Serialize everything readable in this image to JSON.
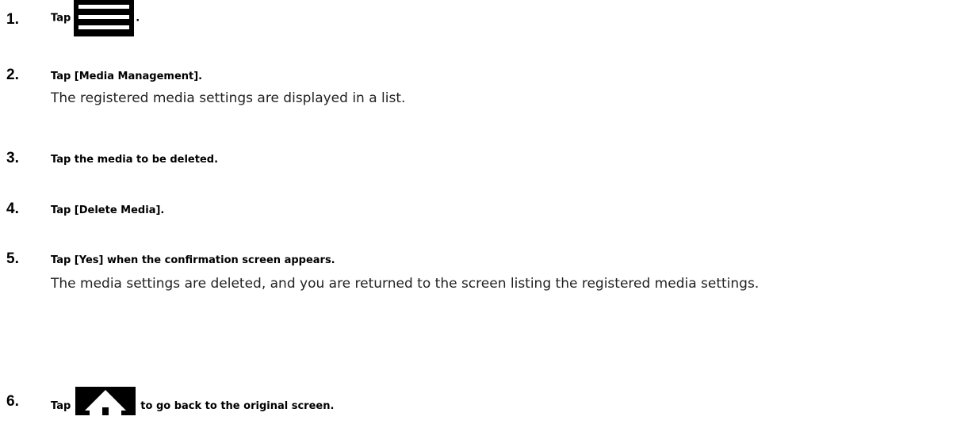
{
  "steps": [
    {
      "number": "1.",
      "before_icon": "Tap",
      "icon": "menu-icon",
      "after_icon": "."
    },
    {
      "number": "2.",
      "instruction": "Tap [Media Management].",
      "result": "The registered media settings are displayed in a list."
    },
    {
      "number": "3.",
      "instruction": "Tap the media to be deleted."
    },
    {
      "number": "4.",
      "instruction": "Tap [Delete Media]."
    },
    {
      "number": "5.",
      "instruction": "Tap [Yes] when the confirmation screen appears.",
      "result": "The media settings are deleted, and you are returned to the screen listing the registered media settings."
    },
    {
      "number": "6.",
      "before_icon": "Tap",
      "icon": "home-icon",
      "after_icon": "to go back to the original screen."
    }
  ]
}
